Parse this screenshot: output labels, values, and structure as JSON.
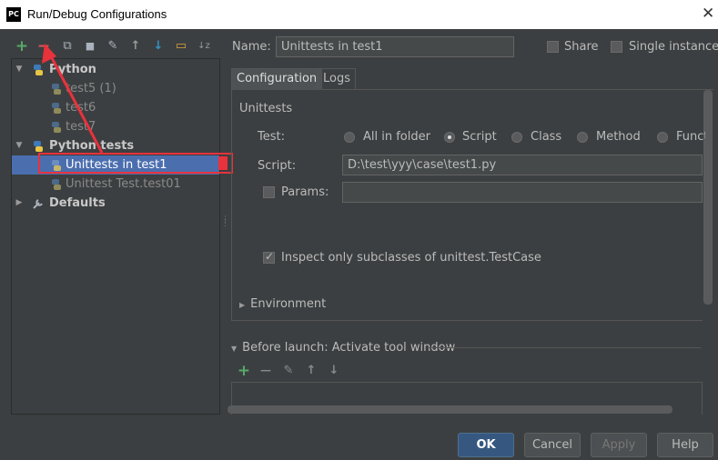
{
  "window": {
    "logo_text": "PC",
    "title": "Run/Debug Configurations",
    "close_glyph": "✕"
  },
  "toolbar": {
    "add_glyph": "+",
    "remove_glyph": "−",
    "copy_glyph": "⧉",
    "save_glyph": "■",
    "edit_defaults_glyph": "✎",
    "move_up_glyph": "↑",
    "move_down_glyph": "↓",
    "folder_glyph": "▭",
    "sort_glyph": "↓z"
  },
  "tree": {
    "groups": [
      {
        "label": "Python",
        "children": [
          "test5 (1)",
          "test6",
          "test7"
        ]
      },
      {
        "label": "Python tests",
        "children": [
          "Unittests in test1",
          "Unittest Test.test01"
        ]
      },
      {
        "label": "Defaults",
        "children": []
      }
    ],
    "selected": "Unittests in test1"
  },
  "header": {
    "name_label": "Name:",
    "name_value": "Unittests in test1",
    "share_label": "Share",
    "single_instance_label": "Single instance",
    "share_checked": false,
    "single_checked": false
  },
  "tabs": [
    {
      "label": "Configuration",
      "active": true
    },
    {
      "label": "Logs",
      "active": false
    }
  ],
  "config": {
    "section_label": "Unittests",
    "test_label": "Test:",
    "test_options": [
      "All in folder",
      "Script",
      "Class",
      "Method",
      "Function"
    ],
    "test_selected": "Script",
    "script_label": "Script:",
    "script_value": "D:\\test\\yyy\\case\\test1.py",
    "params_label": "Params:",
    "params_checked": false,
    "inspect_label": "Inspect only subclasses of unittest.TestCase",
    "inspect_checked": true,
    "environment_label": "Environment"
  },
  "before_launch": {
    "label": "Before launch: Activate tool window",
    "add_glyph": "+",
    "remove_glyph": "−",
    "edit_glyph": "✎",
    "up_glyph": "↑",
    "down_glyph": "↓"
  },
  "buttons": {
    "ok": "OK",
    "cancel": "Cancel",
    "apply": "Apply",
    "help": "Help"
  },
  "colors": {
    "accent_selected": "#4b6eaf",
    "annotation_red": "#e8323c",
    "add_green": "#59a869",
    "remove_red": "#e05555",
    "move_blue": "#3592c4"
  }
}
